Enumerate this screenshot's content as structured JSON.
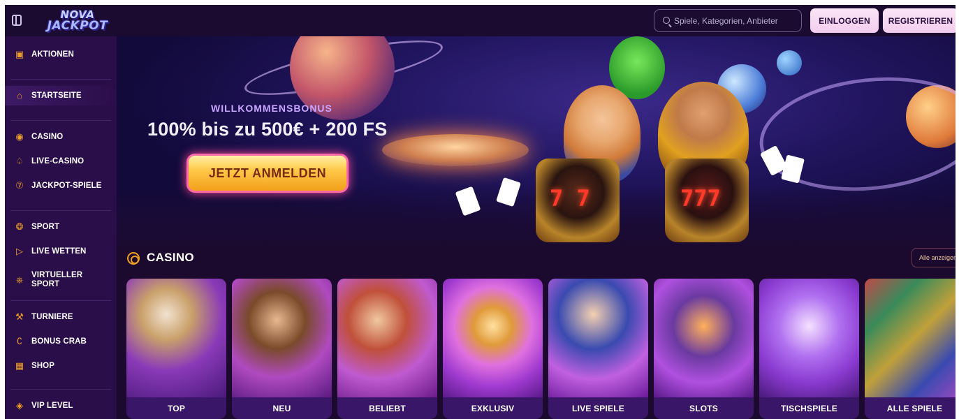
{
  "header": {
    "logo_line1": "NOVA",
    "logo_line2": "JACKPOT",
    "search_placeholder": "Spiele, Kategorien, Anbieter",
    "login_label": "EINLOGGEN",
    "register_label": "REGISTRIEREN"
  },
  "sidebar": {
    "items": [
      {
        "label": "AKTIONEN",
        "icon": "gift-icon"
      },
      {
        "label": "STARTSEITE",
        "icon": "home-icon"
      },
      {
        "label": "CASINO",
        "icon": "casino-chip-icon"
      },
      {
        "label": "LIVE-CASINO",
        "icon": "spade-icon"
      },
      {
        "label": "JACKPOT-SPIELE",
        "icon": "seven-icon"
      },
      {
        "label": "SPORT",
        "icon": "soccer-ball-icon"
      },
      {
        "label": "LIVE WETTEN",
        "icon": "play-icon"
      },
      {
        "label": "VIRTUELLER SPORT",
        "icon": "gamepad-icon"
      },
      {
        "label": "TURNIERE",
        "icon": "trophy-icon"
      },
      {
        "label": "BONUS CRAB",
        "icon": "crab-icon"
      },
      {
        "label": "SHOP",
        "icon": "shop-icon"
      },
      {
        "label": "VIP LEVEL",
        "icon": "diamond-icon"
      }
    ]
  },
  "hero": {
    "bonus_label": "WILLKOMMENSBONUS",
    "bonus_title": "100% bis zu 500€ + 200 FS",
    "cta_label": "JETZT ANMELDEN",
    "slot1": "7 7",
    "slot2": "777"
  },
  "casino": {
    "title": "CASINO",
    "show_all": "Alle anzeigen",
    "tiles": [
      {
        "label": "TOP"
      },
      {
        "label": "NEU"
      },
      {
        "label": "BELIEBT"
      },
      {
        "label": "EXKLUSIV"
      },
      {
        "label": "LIVE SPIELE"
      },
      {
        "label": "SLOTS"
      },
      {
        "label": "TISCHSPIELE"
      },
      {
        "label": "ALLE SPIELE"
      }
    ]
  },
  "colors": {
    "accent": "#f0a020",
    "sidebar_bg": "#2a0e4a",
    "page_bg": "#1b0a2e",
    "button_bg": "#f8dcf2"
  }
}
